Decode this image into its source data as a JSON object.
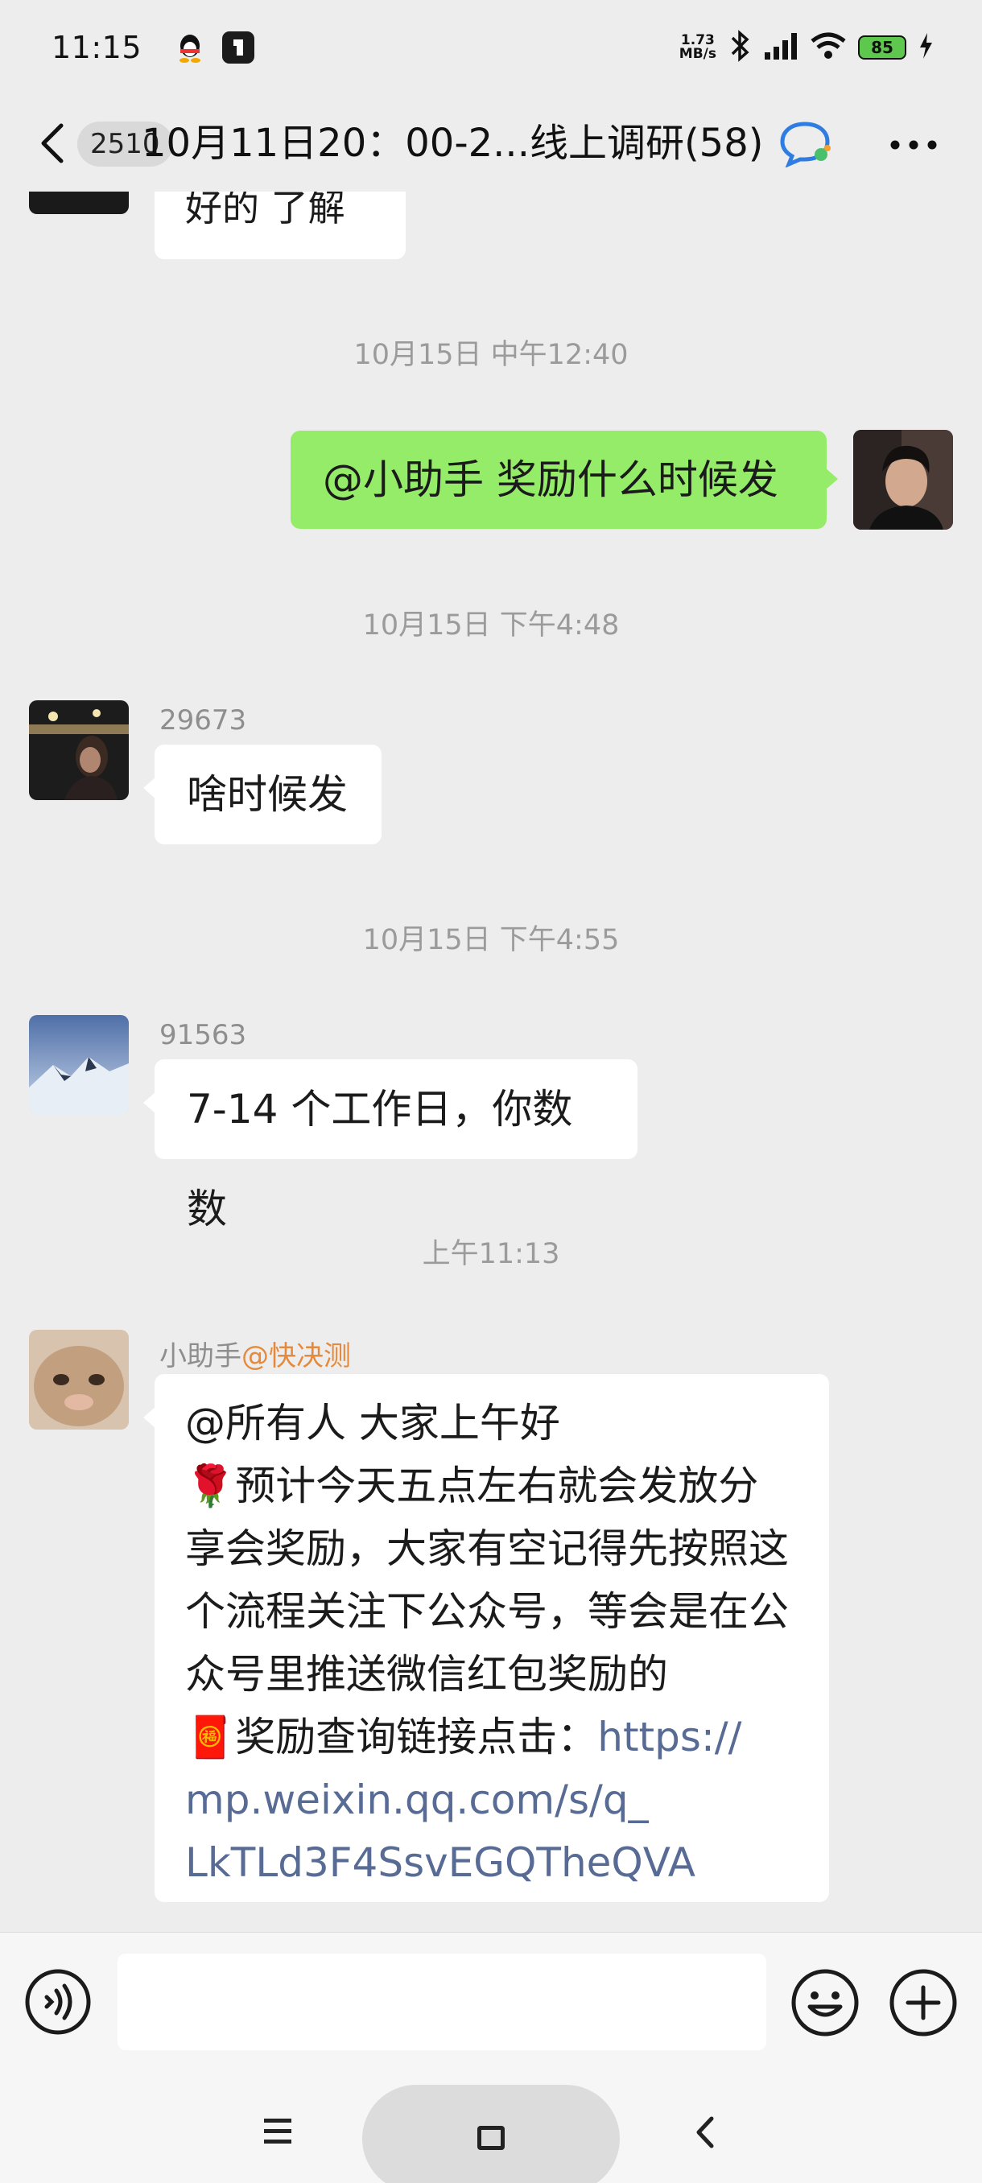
{
  "status_bar": {
    "time": "11:15",
    "net_speed_value": "1.73",
    "net_speed_unit": "MB/s",
    "battery": "85"
  },
  "header": {
    "unread_count": "2510",
    "title": "10月11日20：00-2...线上调研(58)"
  },
  "messages": {
    "top_partial_text": "好的 了解",
    "ts1": "10月15日 中午12:40",
    "my_msg": "@小助手  奖励什么时候发",
    "ts2": "10月15日 下午4:48",
    "m1_name": "29673",
    "m1_text": "啥时候发",
    "ts3": "10月15日 下午4:55",
    "m2_name": "91563",
    "m2_text": "7-14 个工作日，你数数",
    "ts4": "上午11:13",
    "m3_name": "小助手",
    "m3_mention": "@快决测",
    "m3_line1": "@所有人  大家上午好",
    "m3_rose": "🌹",
    "m3_line2": "预计今天五点左右就会发放分",
    "m3_line3": "享会奖励，大家有空记得先按照这",
    "m3_line4": "个流程关注下公众号，等会是在公",
    "m3_line5": "众号里推送微信红包奖励的",
    "m3_red": "🧧",
    "m3_line6": "奖励查询链接点击：",
    "m3_link1": "https://",
    "m3_link2": "mp.weixin.qq.com/s/q_",
    "m3_link3": "LkTLd3F4SsvEGQTheQVA"
  },
  "colors": {
    "bubble_right": "#95ec69",
    "link": "#576b95",
    "mention": "#e58a3c",
    "background": "#ededed"
  }
}
